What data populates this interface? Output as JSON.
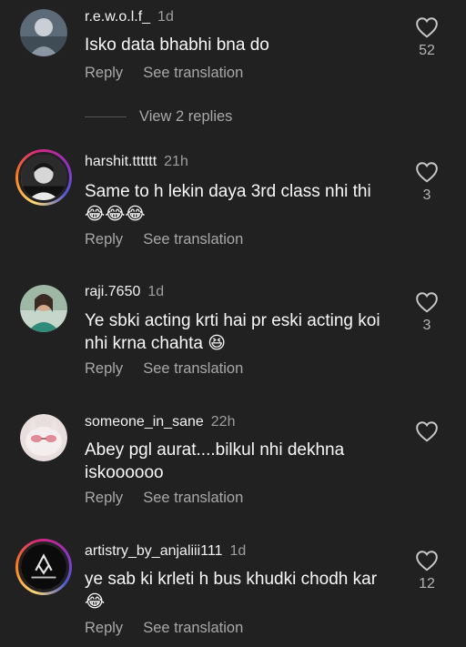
{
  "comments": [
    {
      "username": "r.e.w.o.l.f_",
      "time": "1d",
      "text": "Isko data bhabhi bna do",
      "likes": "52",
      "reply": "Reply",
      "translate": "See translation",
      "view_replies": "View 2 replies"
    },
    {
      "username": "harshit.tttttt",
      "time": "21h",
      "text": "Same to h lekin daya 3rd class nhi thi",
      "text2": "😂😂😂",
      "likes": "3",
      "reply": "Reply",
      "translate": "See translation"
    },
    {
      "username": "raji.7650",
      "time": "1d",
      "text": "Ye sbki acting krti hai pr eski acting koi",
      "text2": "nhi krna chahta 😆",
      "likes": "3",
      "reply": "Reply",
      "translate": "See translation"
    },
    {
      "username": "someone_in_sane",
      "time": "22h",
      "text": "Abey pgl aurat....bilkul nhi dekhna",
      "text2": "iskoooooo",
      "likes": "",
      "reply": "Reply",
      "translate": "See translation"
    },
    {
      "username": "artistry_by_anjaliii111",
      "time": "1d",
      "text": "ye sab ki krleti h bus khudki chodh kar",
      "text2": "😂",
      "likes": "12",
      "reply": "Reply",
      "translate": "See translation"
    }
  ],
  "icons": {
    "like": "heart-outline-icon"
  }
}
